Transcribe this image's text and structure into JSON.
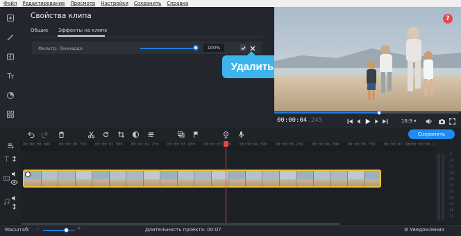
{
  "menu": [
    "Файл",
    "Редактирование",
    "Просмотр",
    "Настройки",
    "Сохранить",
    "Справка"
  ],
  "sidebar": {
    "tools": [
      "import-icon",
      "magic-wand-icon",
      "transitions-icon",
      "text-icon",
      "filters-icon",
      "more-tools-icon"
    ]
  },
  "panel": {
    "title": "Свойства клипа",
    "tabs": [
      {
        "label": "Общие",
        "active": false
      },
      {
        "label": "Эффекты на клипе",
        "active": true
      }
    ],
    "effect": {
      "label": "Фильтр: Леонардо",
      "intensity": 100,
      "intensity_label": "100%"
    }
  },
  "tooltip": {
    "label": "Удалить"
  },
  "player": {
    "help": "?",
    "timecode": "00:00:04",
    "timecode_frames": ".245",
    "aspect": "16:9",
    "progress": 0.57
  },
  "toolbar": {
    "export_label": "Сохранить"
  },
  "ruler": {
    "labels": [
      "00:00:00.000",
      "00:00:00.750",
      "00:00:01.500",
      "00:00:02.250",
      "00:00:03.000",
      "00:00:03.750",
      "00:00:04.500",
      "00:00:05.250",
      "00:00:06.000",
      "00:00:06.750",
      "00:00:07.500",
      "00:00:08.250"
    ]
  },
  "meter": {
    "ticks": [
      "-5",
      "-10",
      "-15",
      "-20",
      "-25",
      "-30",
      "-35",
      "-40",
      "-45",
      "-50",
      "-55"
    ]
  },
  "status": {
    "zoom_label": "Масштаб:",
    "zoom": 0.74,
    "duration_label": "Длительность проекта:",
    "duration_value": "00:07",
    "notifications": "Уведомления"
  },
  "colors": {
    "accent": "#1e8cf0",
    "tooltip": "#3db4ee",
    "playhead": "#e5484d",
    "clip_border": "#f0c23b"
  }
}
